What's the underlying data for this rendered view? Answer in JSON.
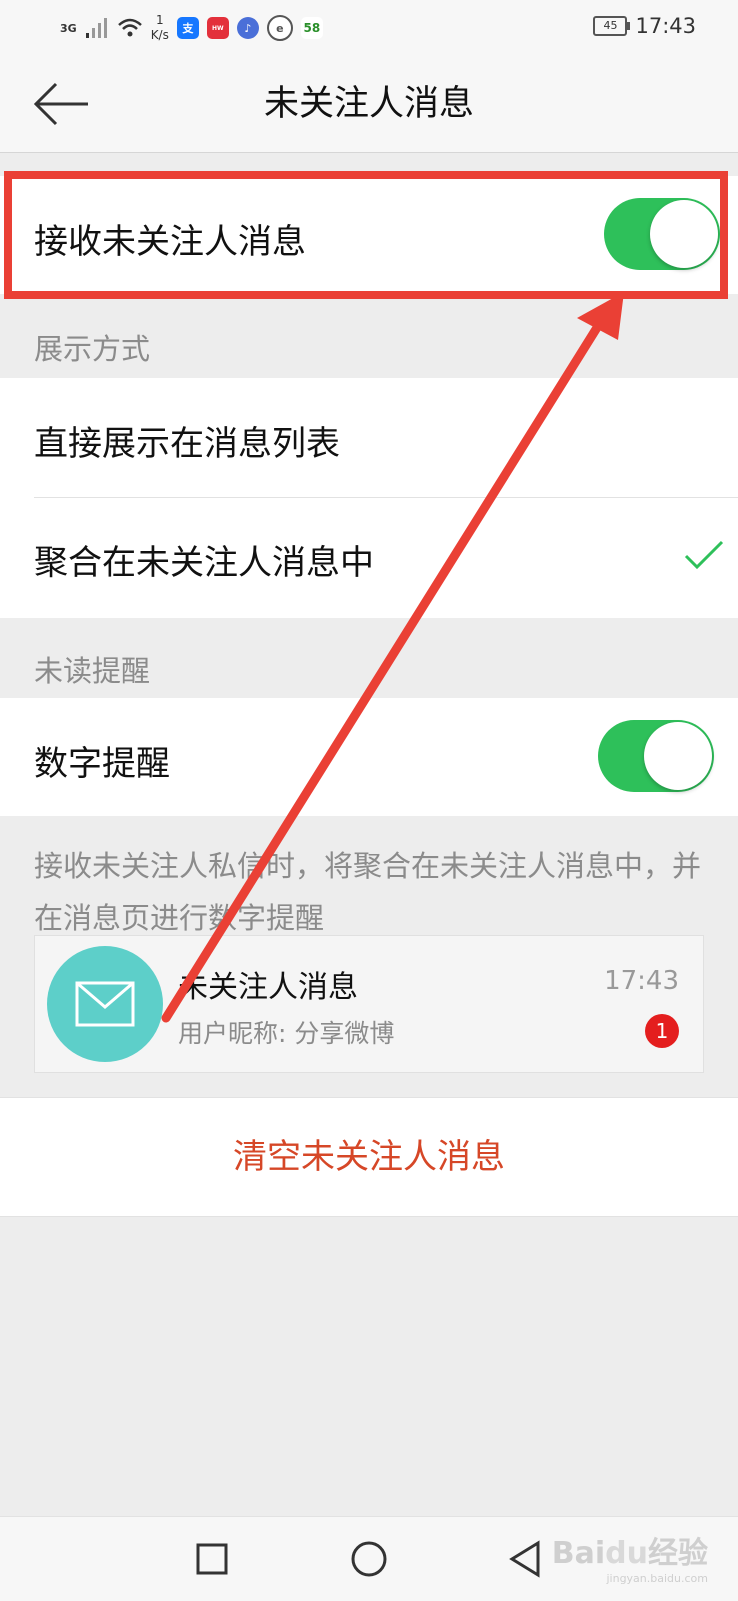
{
  "status_bar": {
    "signal": "3G",
    "net_speed_value": "1",
    "net_speed_unit": "K/s",
    "battery": "45",
    "time": "17:43",
    "notif_app_58": "58"
  },
  "header": {
    "title": "未关注人消息"
  },
  "receive_setting": {
    "label": "接收未关注人消息",
    "enabled": true
  },
  "display_section": {
    "label": "展示方式",
    "options": [
      {
        "label": "直接展示在消息列表",
        "selected": false
      },
      {
        "label": "聚合在未关注人消息中",
        "selected": true
      }
    ]
  },
  "unread_section": {
    "label": "未读提醒",
    "number_reminder_label": "数字提醒",
    "number_reminder_enabled": true,
    "description": "接收未关注人私信时，将聚合在未关注人消息中，并在消息页进行数字提醒"
  },
  "preview": {
    "name": "未关注人消息",
    "subtitle": "用户昵称: 分享微博",
    "time": "17:43",
    "badge": "1"
  },
  "clear_button": {
    "label": "清空未关注人消息"
  },
  "colors": {
    "toggle_on": "#2ec05a",
    "clear_text": "#d64727",
    "highlight": "#ea4035",
    "avatar": "#5dcfc9",
    "badge": "#e41e1e"
  }
}
